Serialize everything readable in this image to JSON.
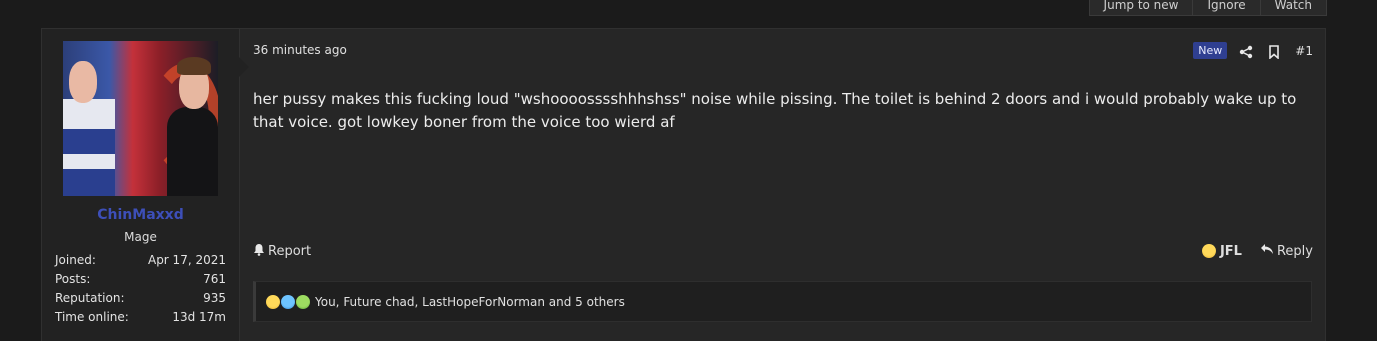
{
  "thread_buttons": [
    "Jump to new",
    "Ignore",
    "Watch"
  ],
  "post": {
    "author": {
      "username": "ChinMaxxd",
      "user_title": "Mage",
      "stats": [
        {
          "label": "Joined:",
          "value": "Apr 17, 2021"
        },
        {
          "label": "Posts:",
          "value": "761"
        },
        {
          "label": "Reputation:",
          "value": "935"
        },
        {
          "label": "Time online:",
          "value": "13d 17m"
        }
      ]
    },
    "date": "36 minutes ago",
    "new_badge": "New",
    "post_number": "#1",
    "message": "her pussy makes this fucking loud \"wshoooosssshhhshss\" noise while pissing. The toilet is behind 2 doors and i would probably wake up to that voice. got lowkey boner from the voice too wierd af",
    "actions": {
      "report_label": "Report",
      "reaction_label": "JFL",
      "reply_label": "Reply"
    },
    "reactions": {
      "summary": "You, Future chad, LastHopeForNorman and 5 others",
      "icons": [
        "laugh-icon",
        "cool-icon",
        "puke-icon"
      ]
    }
  },
  "colors": {
    "username": "#3d4fb8",
    "new_badge_bg": "#2f3f91",
    "background": "#1b1b1b",
    "post_bg": "#262626"
  }
}
